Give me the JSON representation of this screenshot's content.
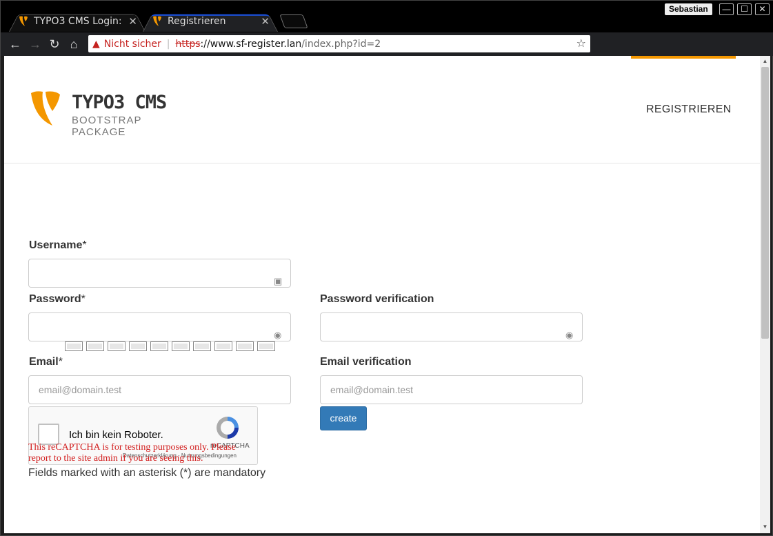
{
  "browser": {
    "tabs": [
      {
        "title": "TYPO3 CMS Login: "
      },
      {
        "title": "Registrieren"
      }
    ],
    "user": "Sebastian",
    "window_controls": {
      "minimize": "—",
      "maximize": "☐",
      "close": "✕"
    },
    "address": {
      "security_label": "Nicht sicher",
      "protocol": "https",
      "host": "://www.sf-register.lan",
      "path": "/index.php?id=2"
    },
    "extensions": [
      "lastpass-icon",
      "ublock-icon",
      "bug-icon",
      "jetbrains-icon",
      "vue-icon",
      "selection-icon",
      "tampermonkey-icon"
    ],
    "colors": {
      "tab_accent": "#1a4fd6",
      "warning": "#c5221f"
    }
  },
  "site": {
    "logo": {
      "title": "TYPO3 CMS",
      "subtitle": "BOOTSTRAP PACKAGE"
    },
    "nav": [
      "REGISTRIEREN"
    ],
    "accent": "#f49700"
  },
  "form": {
    "username": {
      "label": "Username",
      "required": "*"
    },
    "password": {
      "label": "Password",
      "required": "*"
    },
    "password_verification": {
      "label": "Password verification"
    },
    "email": {
      "label": "Email",
      "required": "*",
      "placeholder": "email@domain.test"
    },
    "email_verification": {
      "label": "Email verification",
      "placeholder": "email@domain.test"
    },
    "submit": "create",
    "captcha": {
      "label": "Ich bin kein Roboter.",
      "brand": "reCAPTCHA",
      "links": "Datenschutzerklärung - Nutzungsbedingungen",
      "warning": "This reCAPTCHA is for testing purposes only. Please report to the site admin if you are seeing this."
    },
    "mandatory_note": "Fields marked with an asterisk (*) are mandatory"
  }
}
